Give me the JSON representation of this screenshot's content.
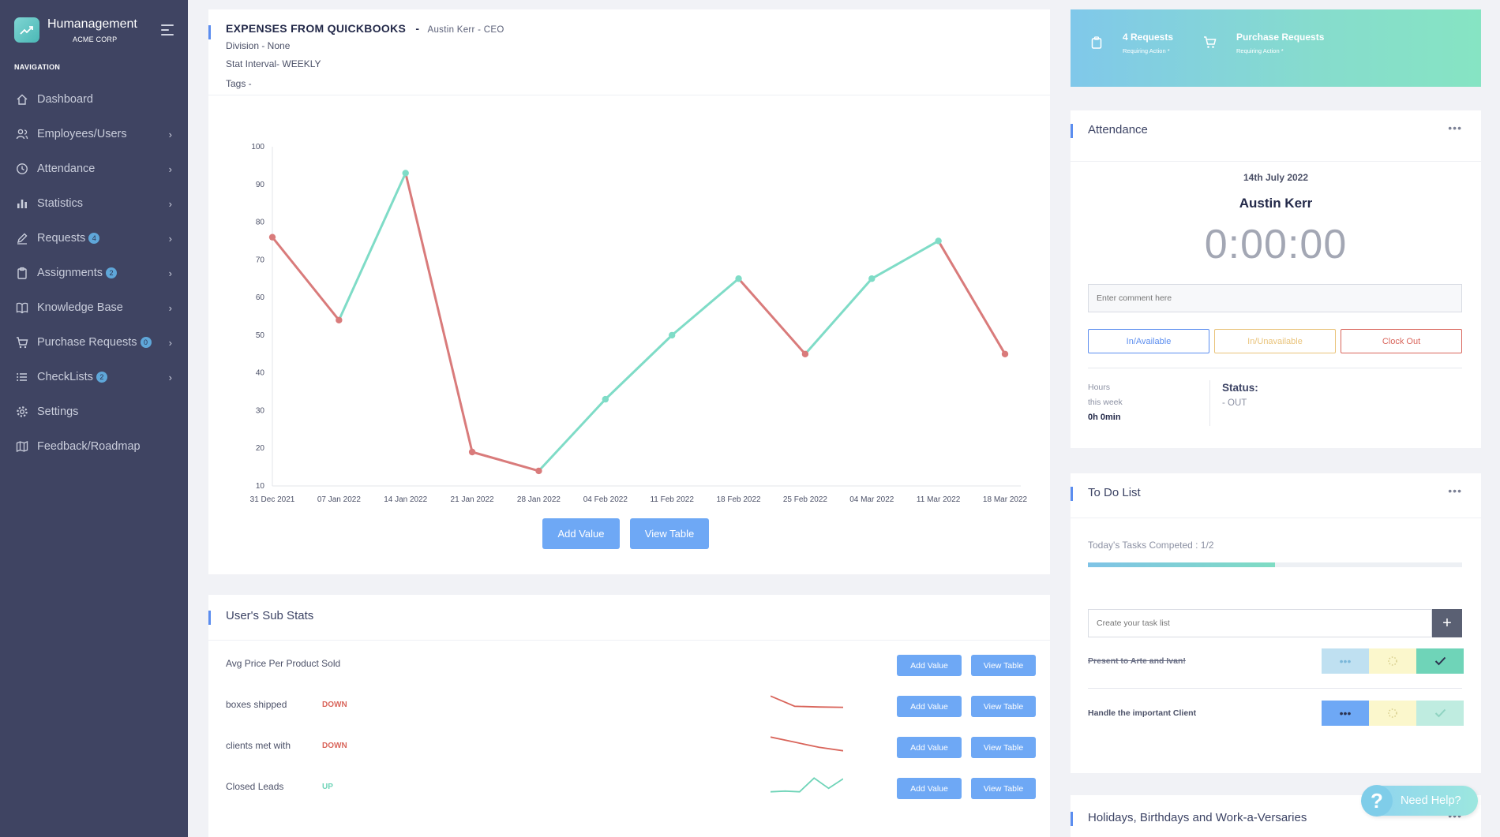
{
  "brand": {
    "name": "Humanagement",
    "company": "ACME CORP"
  },
  "navigation": {
    "label": "NAVIGATION",
    "items": [
      {
        "label": "Dashboard",
        "icon": "home-icon",
        "badge": "",
        "chevron": false
      },
      {
        "label": "Employees/Users",
        "icon": "users-icon",
        "badge": "",
        "chevron": true
      },
      {
        "label": "Attendance",
        "icon": "clock-icon",
        "badge": "",
        "chevron": true
      },
      {
        "label": "Statistics",
        "icon": "bar-chart-icon",
        "badge": "",
        "chevron": true
      },
      {
        "label": "Requests",
        "icon": "edit-icon",
        "badge": "4",
        "chevron": true
      },
      {
        "label": "Assignments",
        "icon": "clipboard-icon",
        "badge": "2",
        "chevron": true
      },
      {
        "label": "Knowledge Base",
        "icon": "book-icon",
        "badge": "",
        "chevron": true
      },
      {
        "label": "Purchase Requests",
        "icon": "cart-icon",
        "badge": "0",
        "chevron": true
      },
      {
        "label": "CheckLists",
        "icon": "list-icon",
        "badge": "2",
        "chevron": true
      },
      {
        "label": "Settings",
        "icon": "gear-icon",
        "badge": "",
        "chevron": false
      },
      {
        "label": "Feedback/Roadmap",
        "icon": "map-icon",
        "badge": "",
        "chevron": false
      }
    ]
  },
  "expenses": {
    "title": "EXPENSES FROM QUICKBOOKS",
    "separator": "-",
    "owner": "Austin Kerr - CEO",
    "division": "Division - None",
    "interval": "Stat Interval- WEEKLY",
    "tags": "Tags -",
    "add_label": "Add Value",
    "view_label": "View Table"
  },
  "chart_data": {
    "type": "line",
    "title": "",
    "xlabel": "",
    "ylabel": "",
    "ylim": [
      10,
      100
    ],
    "yticks": [
      10,
      20,
      30,
      40,
      50,
      60,
      70,
      80,
      90,
      100
    ],
    "categories": [
      "31 Dec 2021",
      "07 Jan 2022",
      "14 Jan 2022",
      "21 Jan 2022",
      "28 Jan 2022",
      "04 Feb 2022",
      "11 Feb 2022",
      "18 Feb 2022",
      "25 Feb 2022",
      "04 Mar 2022",
      "11 Mar 2022",
      "18 Mar 2022"
    ],
    "values": [
      76,
      54,
      93,
      19,
      14,
      33,
      50,
      65,
      45,
      65,
      75,
      45
    ],
    "up_color": "#7fdcc7",
    "down_color": "#d97b7b"
  },
  "substats": {
    "title": "User's Sub Stats",
    "add_label": "Add Value",
    "view_label": "View Table",
    "rows": [
      {
        "name": "Avg Price Per Product Sold",
        "trend": "",
        "trend_color": "",
        "spark": []
      },
      {
        "name": "boxes shipped",
        "trend": "DOWN",
        "trend_color": "#d9655b",
        "spark": [
          14,
          11,
          10.8,
          10.7
        ]
      },
      {
        "name": "clients met with",
        "trend": "DOWN",
        "trend_color": "#d9655b",
        "spark": [
          14,
          12.5,
          11,
          10
        ]
      },
      {
        "name": "Closed Leads",
        "trend": "UP",
        "trend_color": "#6fd4b8",
        "spark": [
          10,
          10.2,
          10,
          14,
          11,
          13.8
        ]
      }
    ]
  },
  "requests_banner": {
    "requests_title": "4 Requests",
    "requests_sub": "Requiring Action *",
    "purchase_title": "Purchase Requests",
    "purchase_sub": "Requiring Action *"
  },
  "attendance": {
    "title": "Attendance",
    "menu": "•••",
    "date": "14th July 2022",
    "name": "Austin Kerr",
    "clock": "0:00:00",
    "comment_placeholder": "Enter comment here",
    "btn_in": "In/Available",
    "btn_unavailable": "In/Unavailable",
    "btn_out": "Clock Out",
    "hours_label_1": "Hours",
    "hours_label_2": "this week",
    "hours_value": "0h 0min",
    "status_label": "Status:",
    "status_value": "- OUT",
    "colors": {
      "in": "#5b8def",
      "unavailable": "#e9c37a",
      "out": "#d9655b"
    }
  },
  "todo": {
    "title": "To Do List",
    "menu": "•••",
    "progress_label": "Today's Tasks Competed : 1/2",
    "progress": 0.5,
    "input_placeholder": "Create your task list",
    "add": "+",
    "tasks": [
      {
        "text": "Present to Arte and Ivan!",
        "done": true
      },
      {
        "text": "Handle the important Client",
        "done": false
      }
    ]
  },
  "holidays": {
    "title": "Holidays, Birthdays and Work-a-Versaries",
    "menu": "•••"
  },
  "help": {
    "label": "Need Help?",
    "q": "?"
  }
}
